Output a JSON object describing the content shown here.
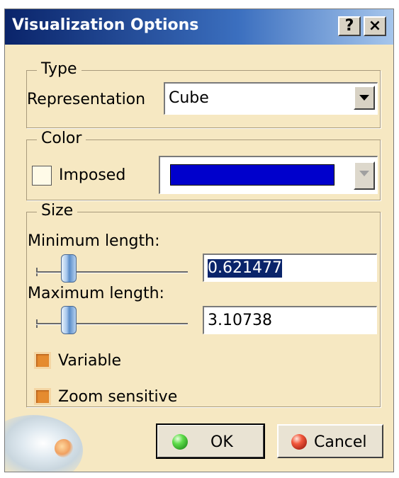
{
  "window": {
    "title": "Visualization Options",
    "help_button": "?",
    "close_button": "×"
  },
  "type_group": {
    "legend": "Type",
    "representation_label": "Representation",
    "representation_value": "Cube"
  },
  "color_group": {
    "legend": "Color",
    "imposed_label": "Imposed",
    "imposed_checked": false,
    "color_swatch": "#0000cc"
  },
  "size_group": {
    "legend": "Size",
    "min_length_label": "Minimum length:",
    "min_length_value": "0.621477",
    "max_length_label": "Maximum length:",
    "max_length_value": "3.10738",
    "variable_label": "Variable",
    "variable_checked": true,
    "zoom_label": "Zoom sensitive",
    "zoom_checked": true
  },
  "buttons": {
    "ok_label": "OK",
    "cancel_label": "Cancel"
  },
  "icons": {
    "help": "help-icon",
    "close": "close-icon",
    "dropdown": "chevron-down-icon",
    "ok": "green-ball-icon",
    "cancel": "red-ball-icon"
  },
  "colors": {
    "dialog_bg": "#f6e8c2",
    "titlebar": "#0a246a",
    "selection": "#0a246a",
    "check_on": "#e58b2f"
  }
}
